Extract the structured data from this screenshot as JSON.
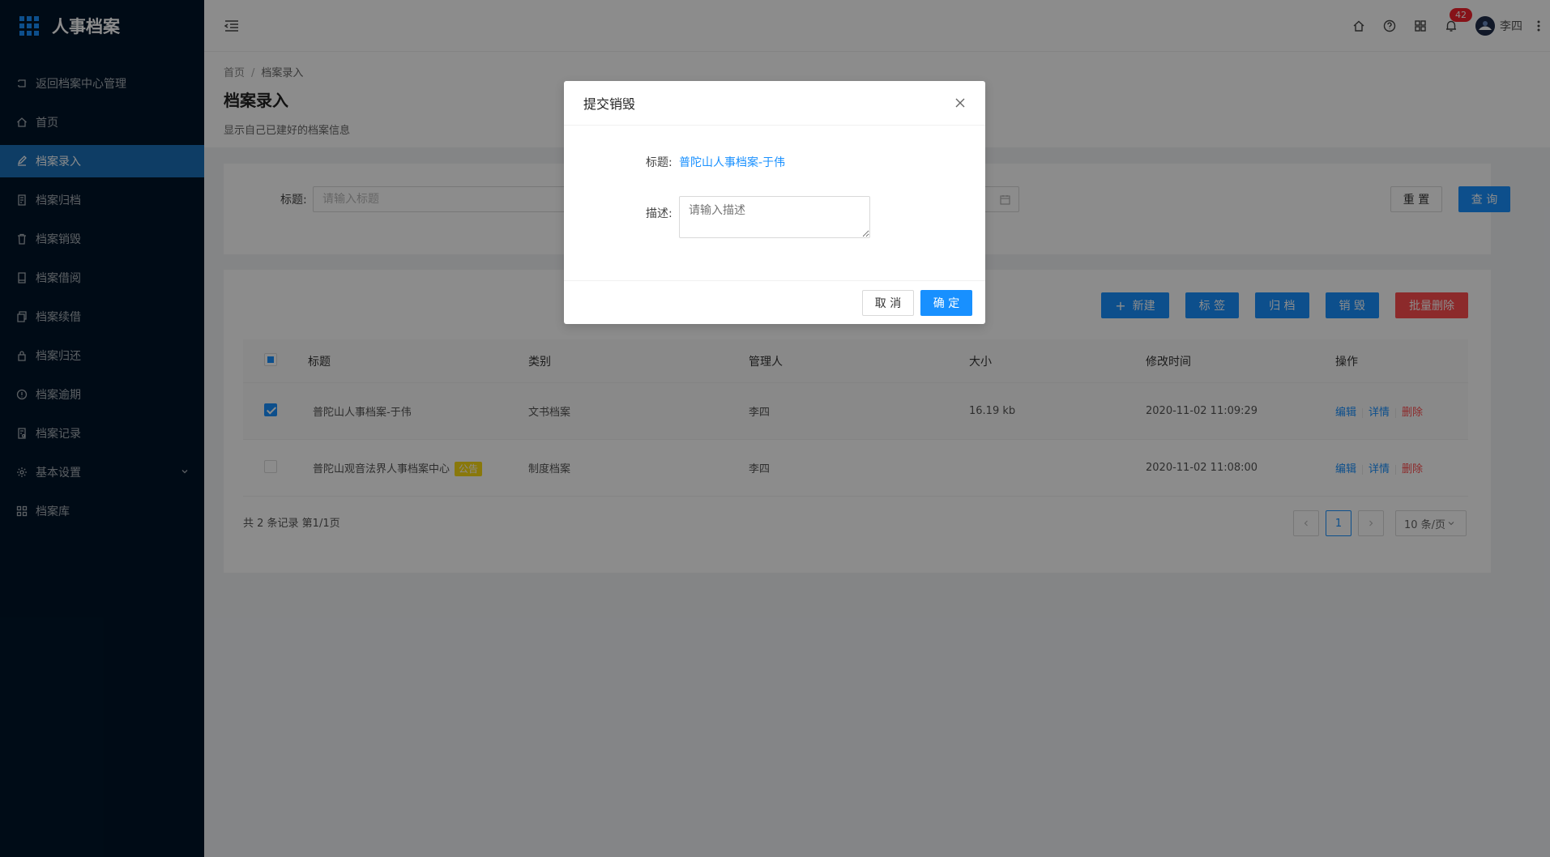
{
  "app": {
    "title": "人事档案"
  },
  "sidebar": {
    "items": [
      {
        "label": "返回档案中心管理",
        "icon": "return-icon"
      },
      {
        "label": "首页",
        "icon": "home-icon"
      },
      {
        "label": "档案录入",
        "icon": "edit-icon",
        "active": true
      },
      {
        "label": "档案归档",
        "icon": "file-icon"
      },
      {
        "label": "档案销毁",
        "icon": "trash-icon"
      },
      {
        "label": "档案借阅",
        "icon": "book-icon"
      },
      {
        "label": "档案续借",
        "icon": "copy-icon"
      },
      {
        "label": "档案归还",
        "icon": "lock-icon"
      },
      {
        "label": "档案逾期",
        "icon": "alert-icon"
      },
      {
        "label": "档案记录",
        "icon": "record-icon"
      },
      {
        "label": "基本设置",
        "icon": "gear-icon",
        "expandable": true
      },
      {
        "label": "档案库",
        "icon": "grid-icon"
      }
    ]
  },
  "header": {
    "notification_count": "42",
    "username": "李四"
  },
  "page": {
    "breadcrumb": [
      "首页",
      "档案录入"
    ],
    "title": "档案录入",
    "description": "显示自己已建好的档案信息"
  },
  "search": {
    "label": "标题:",
    "placeholder": "请输入标题",
    "reset_label": "重 置",
    "query_label": "查 询"
  },
  "toolbar": {
    "new_label": "新建",
    "tag_label": "标 签",
    "archive_label": "归 档",
    "destroy_label": "销 毁",
    "batch_delete_label": "批量删除"
  },
  "table": {
    "columns": [
      "标题",
      "类别",
      "管理人",
      "大小",
      "修改时间",
      "操作"
    ],
    "rows": [
      {
        "title": "普陀山人事档案-于伟",
        "tag": "",
        "category": "文书档案",
        "manager": "李四",
        "size": "16.19 kb",
        "modified": "2020-11-02 11:09:29",
        "checked": true
      },
      {
        "title": "普陀山观音法界人事档案中心",
        "tag": "公告",
        "category": "制度档案",
        "manager": "李四",
        "size": "",
        "modified": "2020-11-02 11:08:00",
        "checked": false
      }
    ],
    "ops": {
      "edit": "编辑",
      "detail": "详情",
      "delete": "删除"
    },
    "summary": "共 2 条记录 第1/1页"
  },
  "pagination": {
    "current_page": "1",
    "page_size": "10 条/页"
  },
  "modal": {
    "title": "提交销毁",
    "title_label": "标题:",
    "title_value": "普陀山人事档案-于伟",
    "desc_label": "描述:",
    "desc_placeholder": "请输入描述",
    "cancel_label": "取 消",
    "ok_label": "确 定"
  },
  "colors": {
    "primary": "#1890ff",
    "danger": "#ff4d4f",
    "sidebar_bg": "#001529",
    "sidebar_active": "#1a6fb8",
    "tag_bg": "#fadb14"
  }
}
